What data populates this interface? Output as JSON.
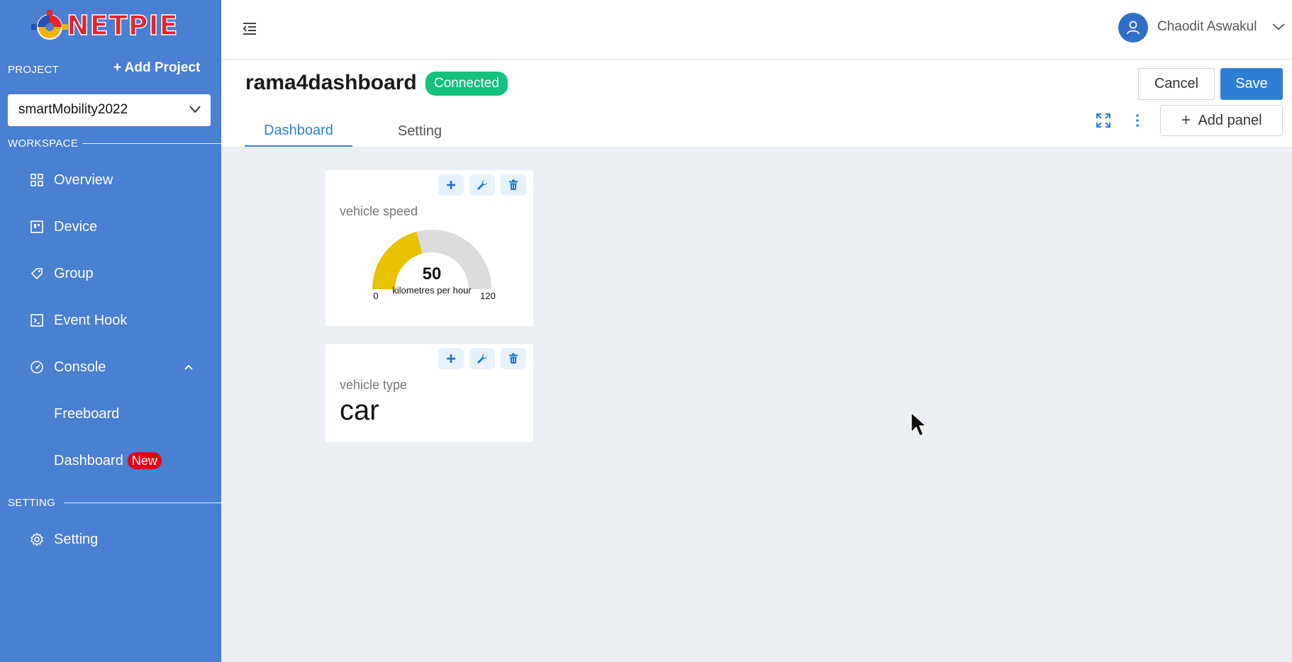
{
  "sidebar": {
    "logo_text": "NETPIE",
    "project_label": "PROJECT",
    "add_project_label": "+ Add Project",
    "project_selected": "smartMobility2022",
    "workspace_label": "WORKSPACE",
    "setting_section_label": "SETTING",
    "items": [
      {
        "label": "Overview",
        "icon": "grid-icon"
      },
      {
        "label": "Device",
        "icon": "device-icon"
      },
      {
        "label": "Group",
        "icon": "tag-icon"
      },
      {
        "label": "Event Hook",
        "icon": "terminal-icon"
      },
      {
        "label": "Console",
        "icon": "gauge-icon",
        "expanded": true
      },
      {
        "label": "Freeboard"
      },
      {
        "label": "Dashboard",
        "badge": "New"
      },
      {
        "label": "Setting",
        "icon": "gear-icon"
      }
    ]
  },
  "topbar": {
    "user_name": "Chaodit Aswakul"
  },
  "header": {
    "title": "rama4dashboard",
    "status": "Connected",
    "cancel_label": "Cancel",
    "save_label": "Save",
    "tabs": [
      {
        "label": "Dashboard",
        "active": true
      },
      {
        "label": "Setting",
        "active": false
      }
    ],
    "add_panel_label": "Add panel"
  },
  "panels": [
    {
      "title": "vehicle speed",
      "type": "gauge",
      "value": "50",
      "unit": "kilometres per hour",
      "min": "0",
      "max": "120",
      "value_fraction": 0.4167,
      "fill_color": "#e6c200",
      "track_color": "#dcdcdc"
    },
    {
      "title": "vehicle type",
      "type": "text",
      "value": "car"
    }
  ],
  "colors": {
    "sidebar_bg": "#4a7fd1",
    "accent": "#2f7fd6",
    "status_connected": "#13c27d",
    "badge_new": "#e60012"
  }
}
